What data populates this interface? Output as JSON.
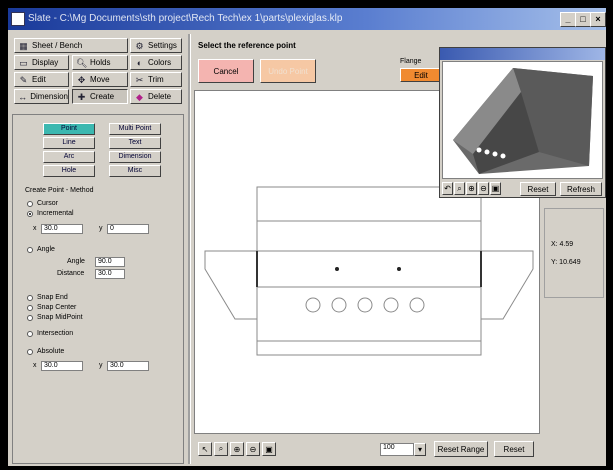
{
  "window": {
    "title": "Slate - C:\\Mg Documents\\sth project\\Rech Tech\\ex 1\\parts\\plexiglas.klp",
    "controls": [
      "_",
      "□",
      "×"
    ]
  },
  "toolbar": {
    "buttons": [
      {
        "label": "Sheet / Bench",
        "icon": "sheet-icon"
      },
      {
        "label": "Settings",
        "icon": "gear-icon"
      },
      {
        "label": "Display",
        "icon": "display-icon"
      },
      {
        "label": "Holds",
        "icon": "magnifier-icon"
      },
      {
        "label": "Colors",
        "icon": "colors-icon"
      },
      {
        "label": "Edit",
        "icon": "edit-icon"
      },
      {
        "label": "Move",
        "icon": "move-icon"
      },
      {
        "label": "Trim",
        "icon": "trim-icon"
      },
      {
        "label": "Dimension",
        "icon": "dimension-icon"
      },
      {
        "label": "Create",
        "icon": "create-icon"
      },
      {
        "label": "Delete",
        "icon": "delete-icon"
      }
    ]
  },
  "create_panel": {
    "tools": [
      "Point",
      "Multi Point",
      "Line",
      "Text",
      "Arc",
      "Dimension",
      "Hole",
      "Misc"
    ],
    "selected_tool": "Point",
    "method_title": "Create Point - Method",
    "methods": [
      {
        "label": "Cursor",
        "checked": false
      },
      {
        "label": "Incremental",
        "checked": true
      },
      {
        "label": "Angle",
        "checked": false
      },
      {
        "label": "Snap End",
        "checked": false
      },
      {
        "label": "Snap Center",
        "checked": false
      },
      {
        "label": "Snap MidPoint",
        "checked": false
      },
      {
        "label": "Intersection",
        "checked": false
      },
      {
        "label": "Absolute",
        "checked": false
      }
    ],
    "incremental": {
      "x_label": "x",
      "x_value": "30.0",
      "y_label": "y",
      "y_value": "0"
    },
    "angle": {
      "angle_label": "Angle",
      "angle_value": "90.0",
      "distance_label": "Distance",
      "distance_value": "30.0"
    },
    "absolute": {
      "x_label": "x",
      "x_value": "30.0",
      "y_label": "y",
      "y_value": "30.0"
    }
  },
  "header": {
    "prompt": "Select the reference point",
    "cancel_label": "Cancel",
    "second_label": "Undo Point",
    "flange_label": "Flange",
    "flange_value": "Edit"
  },
  "popup3d": {
    "reset_label": "Reset",
    "refresh_label": "Refresh"
  },
  "coords": {
    "x": "X: 4.59",
    "y": "Y: 10.649"
  },
  "bottom": {
    "zoom_value": "100",
    "reset_range_label": "Reset Range",
    "reset_label": "Reset"
  }
}
